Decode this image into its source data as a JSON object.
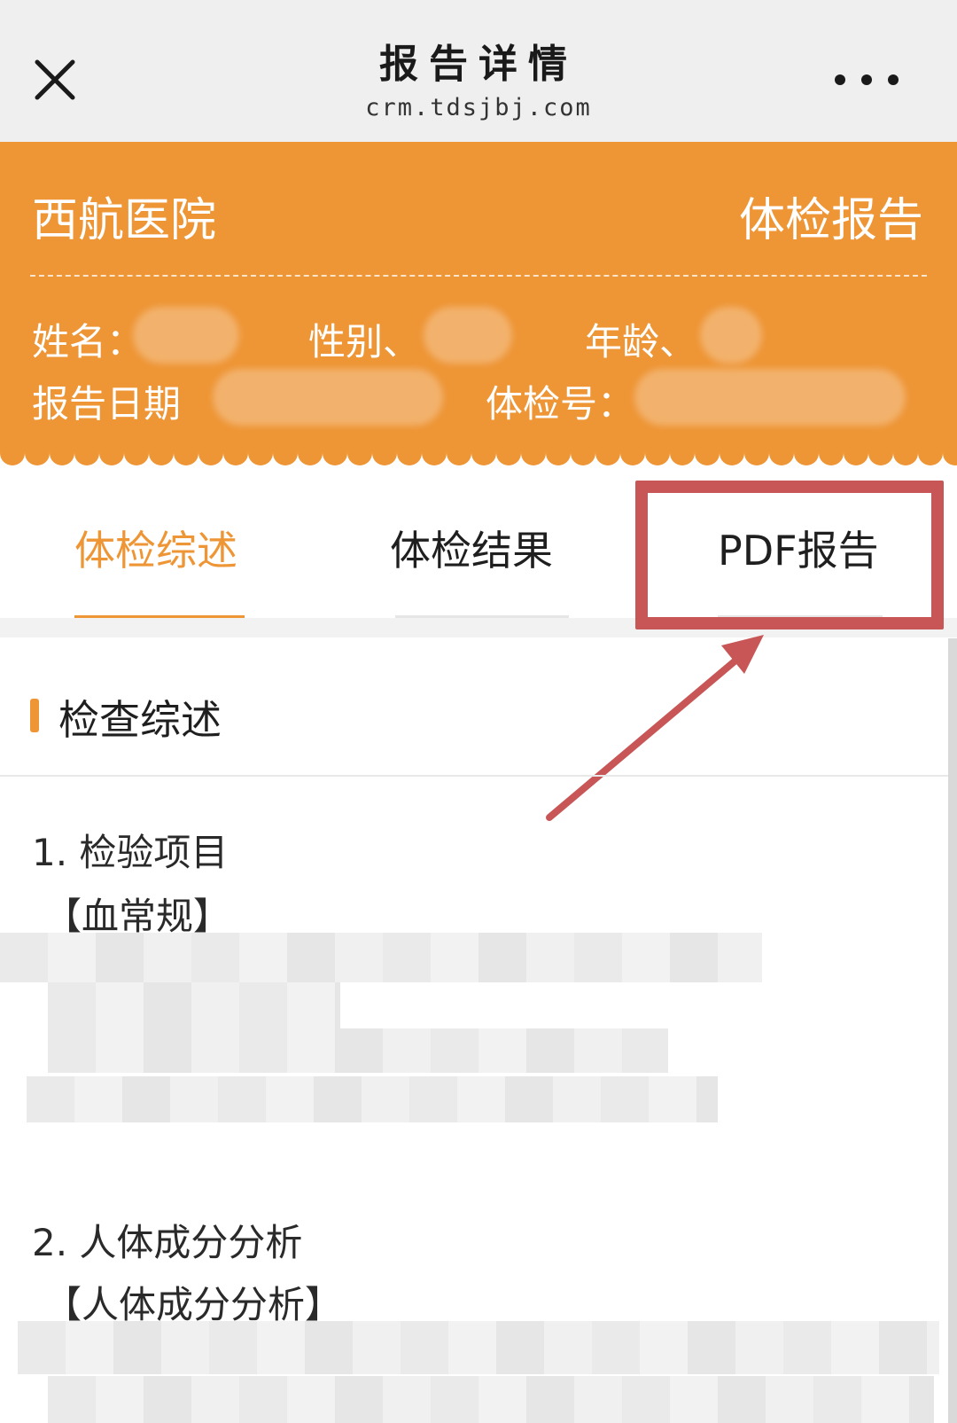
{
  "nav": {
    "title": "报告详情",
    "url": "crm.tdsjbj.com",
    "close_icon": "close-icon",
    "more_icon": "more-dots-icon"
  },
  "header": {
    "hospital": "西航医院",
    "report_type": "体检报告",
    "name_label": "姓名：",
    "gender_label": "性别、",
    "age_label": "年龄、",
    "date_label": "报告日期",
    "exam_no_label": "体检号："
  },
  "tabs": [
    {
      "label": "体检综述"
    },
    {
      "label": "体检结果"
    },
    {
      "label": "PDF报告"
    }
  ],
  "content": {
    "section_title": "检查综述",
    "item1_title": "1. 检验项目",
    "item1_sub": "【血常规】",
    "item2_title": "2. 人体成分分析",
    "item2_sub": "【人体成分分析】"
  },
  "colors": {
    "accent": "#ee9535",
    "annotation": "#c85656"
  }
}
